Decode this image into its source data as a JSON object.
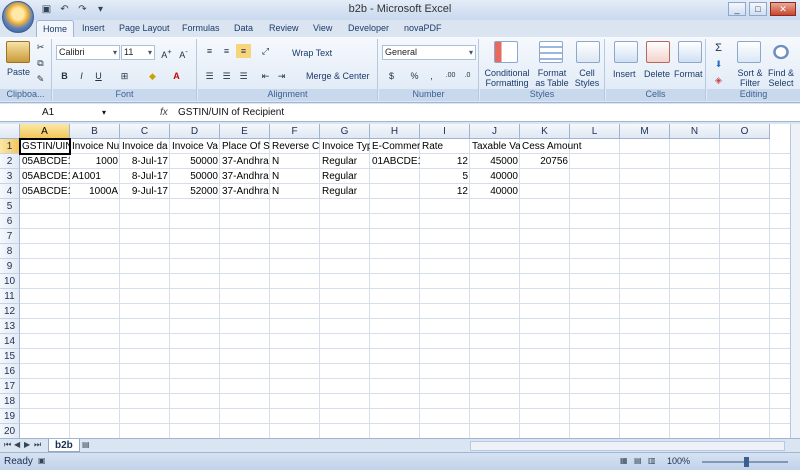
{
  "app": {
    "title": "b2b - Microsoft Excel"
  },
  "tabs": [
    "Home",
    "Insert",
    "Page Layout",
    "Formulas",
    "Data",
    "Review",
    "View",
    "Developer",
    "novaPDF"
  ],
  "ribbon": {
    "clipboard": {
      "label": "Clipboa...",
      "paste": "Paste"
    },
    "font": {
      "label": "Font",
      "name": "Calibri",
      "size": "11",
      "bold": "B",
      "italic": "I",
      "underline": "U"
    },
    "alignment": {
      "label": "Alignment",
      "wrap": "Wrap Text",
      "merge": "Merge & Center"
    },
    "number": {
      "label": "Number",
      "format": "General",
      "currency": "$",
      "percent": "%",
      "comma": ","
    },
    "styles": {
      "label": "Styles",
      "conditional": "Conditional Formatting",
      "format_table": "Format as Table",
      "cell_styles": "Cell Styles"
    },
    "cells": {
      "label": "Cells",
      "insert": "Insert",
      "delete": "Delete",
      "format": "Format"
    },
    "editing": {
      "label": "Editing",
      "sort": "Sort & Filter",
      "find": "Find & Select"
    }
  },
  "formula_bar": {
    "name_box": "A1",
    "fx": "fx",
    "content": "GSTIN/UIN of Recipient"
  },
  "columns": [
    "A",
    "B",
    "C",
    "D",
    "E",
    "F",
    "G",
    "H",
    "I",
    "J",
    "K",
    "L",
    "M",
    "N",
    "O"
  ],
  "rows": [
    "1",
    "2",
    "3",
    "4",
    "5",
    "6",
    "7",
    "8",
    "9",
    "10",
    "11",
    "12",
    "13",
    "14",
    "15",
    "16",
    "17",
    "18",
    "19",
    "20"
  ],
  "cells": {
    "r1": [
      "GSTIN/UIN",
      "Invoice Nu",
      "Invoice da",
      "Invoice Va",
      "Place Of Su",
      "Reverse Ch",
      "Invoice Typ",
      "E-Commer",
      "Rate",
      "",
      "Taxable Va",
      "Cess Amount"
    ],
    "r2": [
      "05ABCDE1",
      "1000",
      "8-Jul-17",
      "50000",
      "37-Andhra",
      "N",
      "Regular",
      "01ABCDE1",
      "12",
      "45000",
      "20756"
    ],
    "r3": [
      "05ABCDE1",
      "A1001",
      "8-Jul-17",
      "50000",
      "37-Andhra",
      "N",
      "Regular",
      "",
      "5",
      "40000"
    ],
    "r4": [
      "05ABCDE1",
      "1000A",
      "9-Jul-17",
      "52000",
      "37-Andhra",
      "N",
      "Regular",
      "",
      "12",
      "40000"
    ]
  },
  "sheet_tab": "b2b",
  "status": {
    "ready": "Ready",
    "zoom": "100%"
  }
}
